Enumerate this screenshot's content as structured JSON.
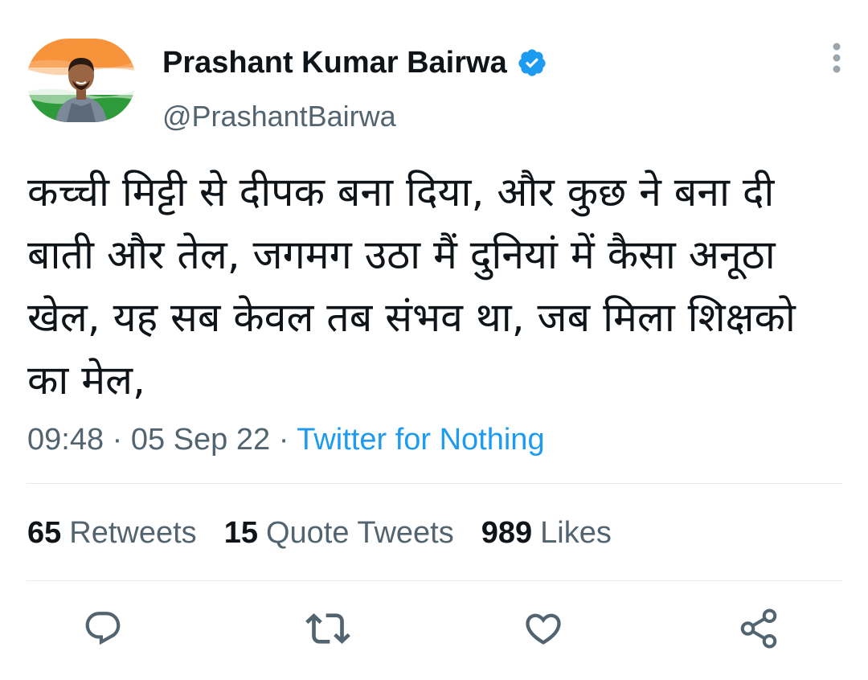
{
  "author": {
    "display_name": "Prashant Kumar Bairwa",
    "handle": "@PrashantBairwa",
    "verified": true,
    "verified_icon": "verified-badge-icon",
    "avatar_desc_colors": {
      "saffron": "#f7933b",
      "white": "#ffffff",
      "green": "#2e9b3a"
    }
  },
  "tweet": {
    "text": "कच्ची मिट्टी से दीपक बना दिया, और कुछ ने बना दी बाती और तेल, जगमग उठा मैं दुनियां में कैसा अनूठा खेल, यह सब केवल तब संभव था, जब मिला शिक्षको का मेल,",
    "time": "09:48",
    "separator1": " · ",
    "date": "05 Sep 22",
    "separator2": " · ",
    "source": "Twitter for Nothing"
  },
  "stats": {
    "retweets": {
      "count": "65",
      "label": "Retweets"
    },
    "quotes": {
      "count": "15",
      "label": "Quote Tweets"
    },
    "likes": {
      "count": "989",
      "label": "Likes"
    }
  },
  "actions": {
    "reply_icon": "reply-icon",
    "retweet_icon": "retweet-icon",
    "like_icon": "like-icon",
    "share_icon": "share-icon"
  },
  "colors": {
    "text": "#0f1419",
    "secondary": "#536471",
    "accent": "#1d9bf0",
    "divider": "#e7e9ea"
  }
}
